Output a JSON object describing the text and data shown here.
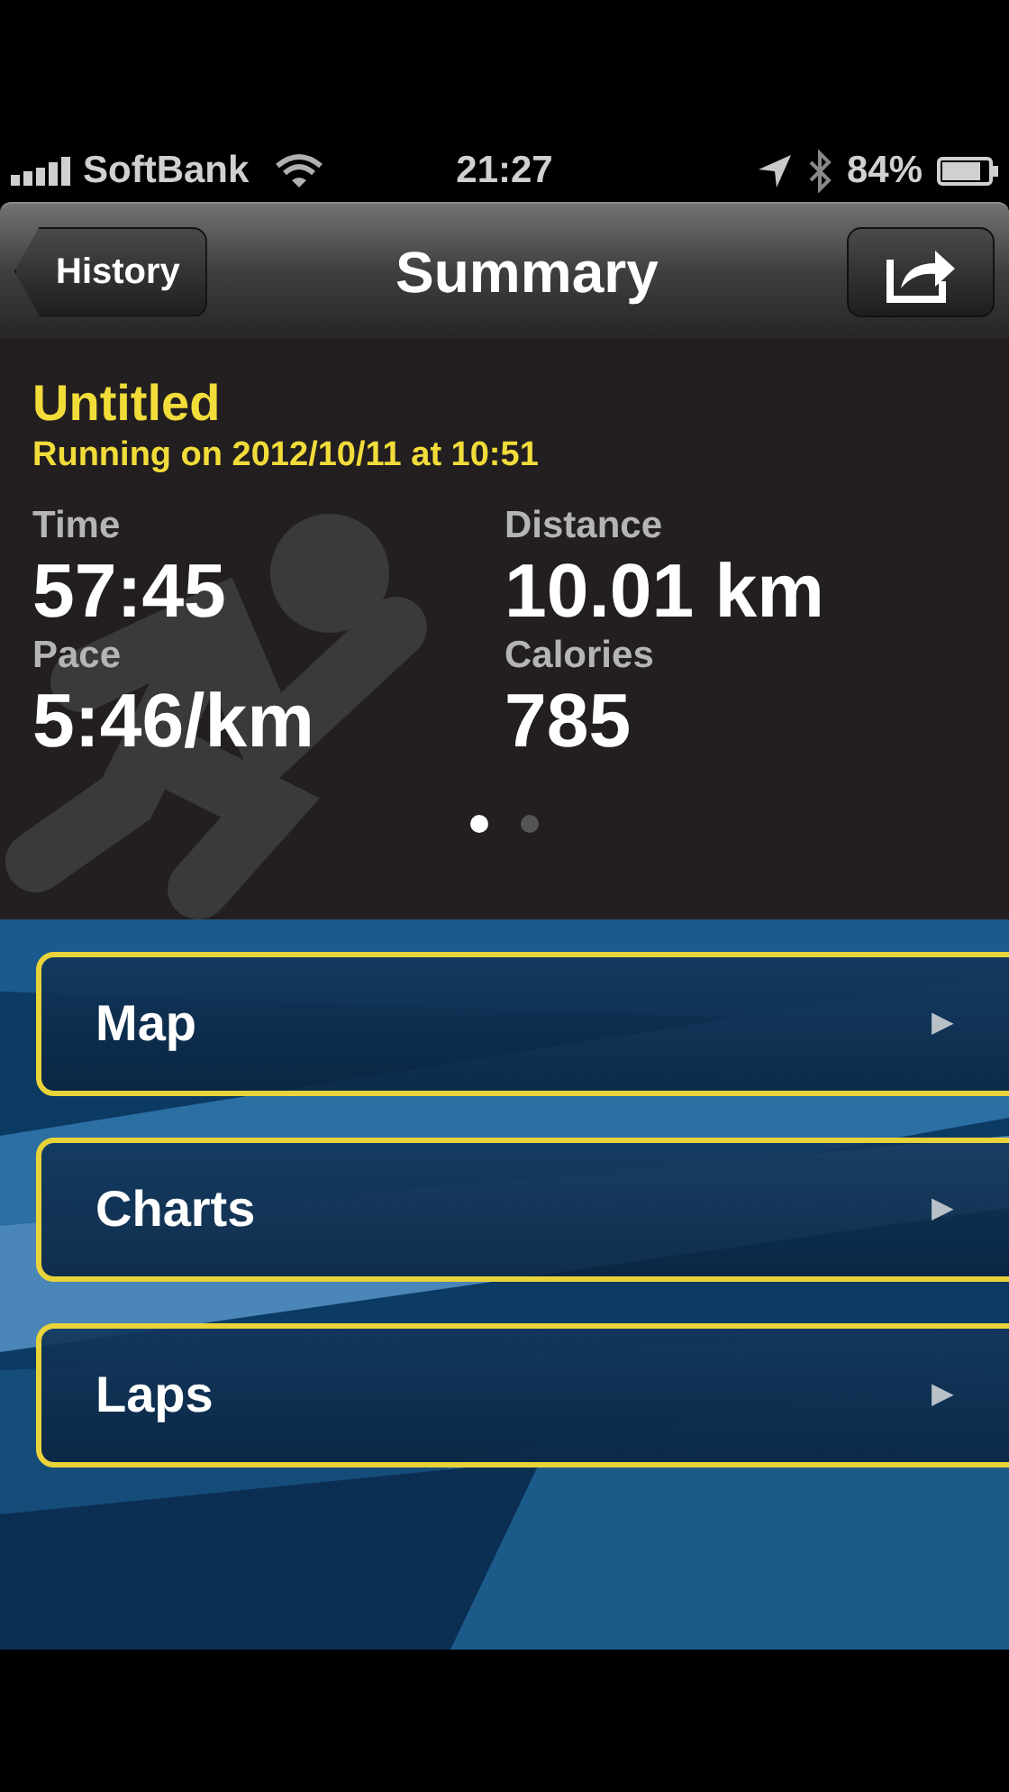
{
  "status_bar": {
    "carrier": "SoftBank",
    "time": "21:27",
    "battery": "84%"
  },
  "nav_bar": {
    "back": "History",
    "title": "Summary"
  },
  "summary": {
    "title": "Untitled",
    "subtitle": "Running on 2012/10/11 at 10:51",
    "stats": [
      {
        "label": "Time",
        "value": "57:45"
      },
      {
        "label": "Distance",
        "value": "10.01 km"
      },
      {
        "label": "Pace",
        "value": "5:46/km"
      },
      {
        "label": "Calories",
        "value": "785"
      }
    ],
    "pages": [
      {
        "selected": true
      },
      {
        "selected": false
      }
    ]
  },
  "menu": [
    {
      "label": "Map",
      "arrow": "▶"
    },
    {
      "label": "Charts",
      "arrow": "▶"
    },
    {
      "label": "Laps",
      "arrow": "▶"
    }
  ]
}
